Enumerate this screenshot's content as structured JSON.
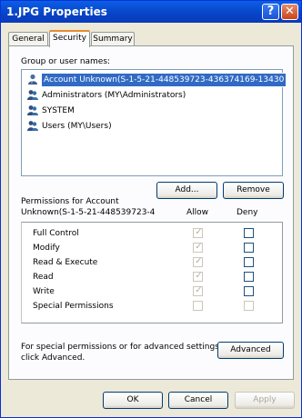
{
  "window": {
    "title": "1.JPG Properties",
    "help_label": "?",
    "close_label": "✕"
  },
  "tabs": [
    {
      "label": "General",
      "active": false
    },
    {
      "label": "Security",
      "active": true
    },
    {
      "label": "Summary",
      "active": false
    }
  ],
  "groups": {
    "heading": "Group or user names:",
    "items": [
      {
        "label": "Account Unknown(S-1-5-21-448539723-436374169-13430",
        "icon": "unknown-user-icon",
        "selected": true
      },
      {
        "label": "Administrators (MY\\Administrators)",
        "icon": "group-icon",
        "selected": false
      },
      {
        "label": "SYSTEM",
        "icon": "group-icon",
        "selected": false
      },
      {
        "label": "Users (MY\\Users)",
        "icon": "group-icon",
        "selected": false
      }
    ],
    "add_label": "Add...",
    "remove_label": "Remove"
  },
  "permissions": {
    "heading_line1": "Permissions for Account",
    "heading_line2": "Unknown(S-1-5-21-448539723-4",
    "allow_label": "Allow",
    "deny_label": "Deny",
    "rows": [
      {
        "label": "Full Control",
        "allow": true,
        "deny": false
      },
      {
        "label": "Modify",
        "allow": true,
        "deny": false
      },
      {
        "label": "Read & Execute",
        "allow": true,
        "deny": false
      },
      {
        "label": "Read",
        "allow": true,
        "deny": false
      },
      {
        "label": "Write",
        "allow": true,
        "deny": false
      },
      {
        "label": "Special Permissions",
        "allow": false,
        "deny": false
      }
    ]
  },
  "advanced": {
    "text_line1": "For special permissions or for advanced settings,",
    "text_line2": "click Advanced.",
    "button_label": "Advanced"
  },
  "footer": {
    "ok_label": "OK",
    "cancel_label": "Cancel",
    "apply_label": "Apply"
  }
}
